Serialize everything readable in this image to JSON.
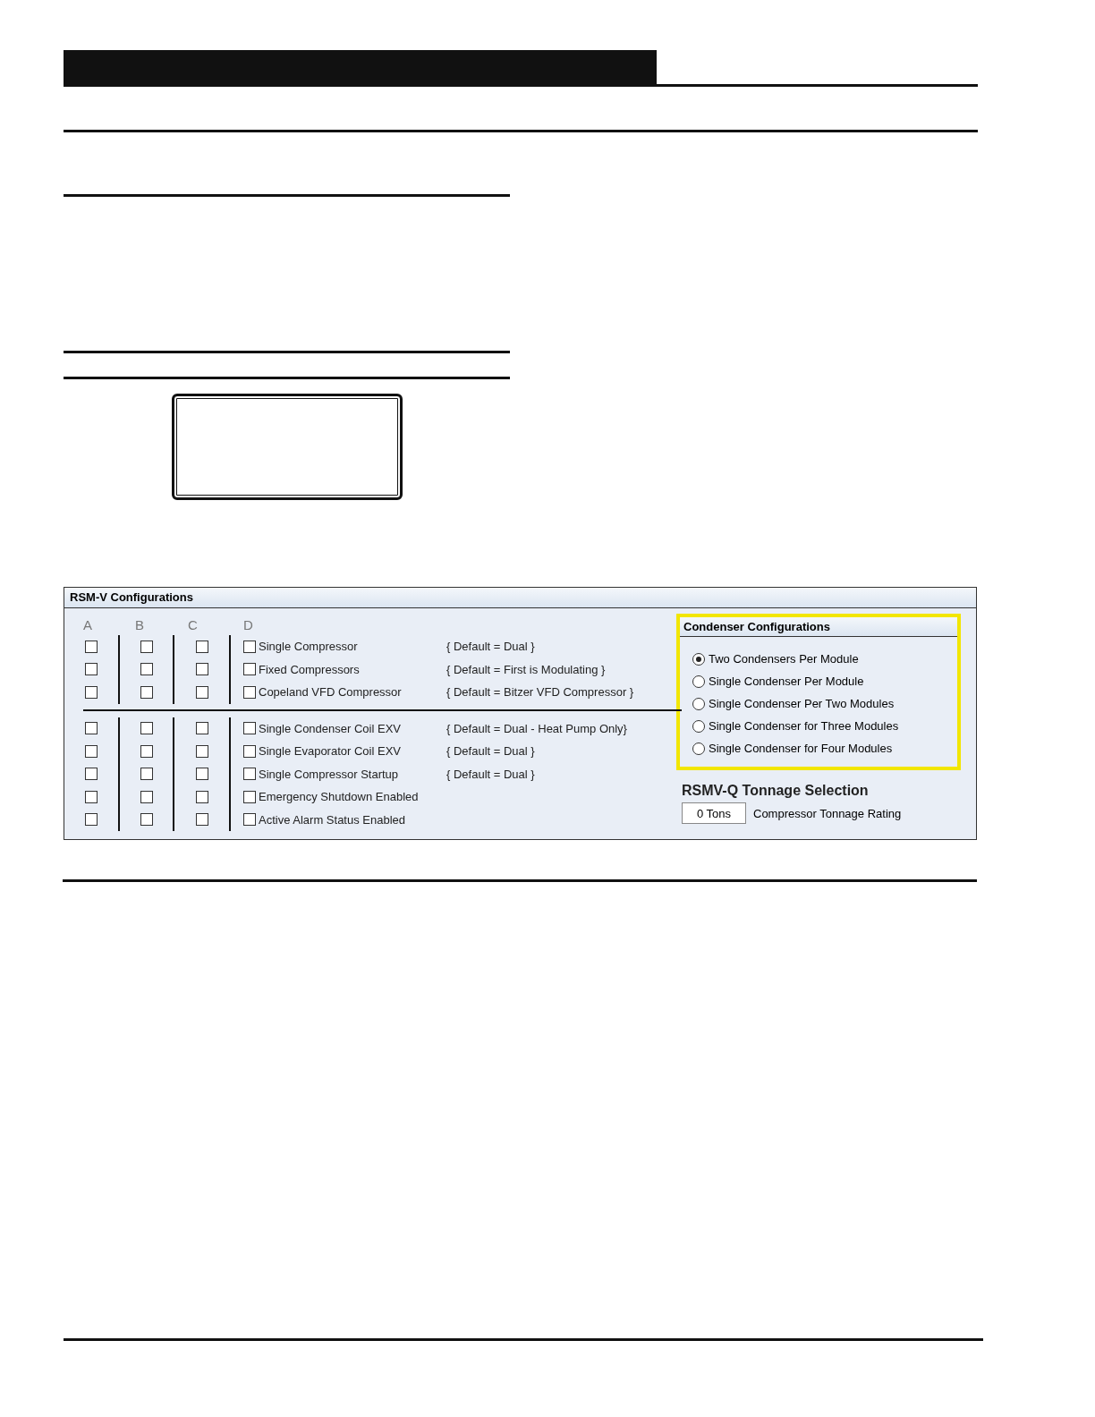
{
  "panel": {
    "title": "RSM-V Configurations",
    "columns": [
      "A",
      "B",
      "C",
      "D"
    ],
    "groups": [
      {
        "rows": [
          {
            "label": "Single Compressor",
            "default": "{ Default = Dual }",
            "checks": [
              false,
              false,
              false,
              false
            ]
          },
          {
            "label": "Fixed Compressors",
            "default": "{ Default = First is Modulating }",
            "checks": [
              false,
              false,
              false,
              false
            ]
          },
          {
            "label": "Copeland VFD Compressor",
            "default": "{ Default = Bitzer VFD Compressor }",
            "checks": [
              false,
              false,
              false,
              false
            ]
          }
        ]
      },
      {
        "rows": [
          {
            "label": "Single Condenser Coil EXV",
            "default": "{ Default = Dual - Heat Pump Only}",
            "checks": [
              false,
              false,
              false,
              false
            ]
          },
          {
            "label": "Single Evaporator Coil EXV",
            "default": "{ Default = Dual }",
            "checks": [
              false,
              false,
              false,
              false
            ]
          },
          {
            "label": "Single Compressor Startup",
            "default": "{ Default = Dual }",
            "checks": [
              false,
              false,
              false,
              false
            ]
          },
          {
            "label": "Emergency Shutdown Enabled",
            "checks": [
              false,
              false,
              false,
              false
            ]
          },
          {
            "label": "Active Alarm Status Enabled",
            "checks": [
              false,
              false,
              false,
              false
            ]
          }
        ]
      }
    ],
    "condenser": {
      "title": "Condenser Configurations",
      "highlighted": true,
      "options": [
        {
          "label": "Two Condensers Per Module",
          "selected": true
        },
        {
          "label": "Single Condenser Per Module",
          "selected": false
        },
        {
          "label": "Single Condenser Per Two Modules",
          "selected": false
        },
        {
          "label": "Single Condenser for Three Modules",
          "selected": false
        },
        {
          "label": "Single Condenser for Four Modules",
          "selected": false
        }
      ]
    },
    "tonnage": {
      "title": "RSMV-Q Tonnage Selection",
      "value": "0 Tons",
      "label": "Compressor Tonnage Rating"
    }
  }
}
